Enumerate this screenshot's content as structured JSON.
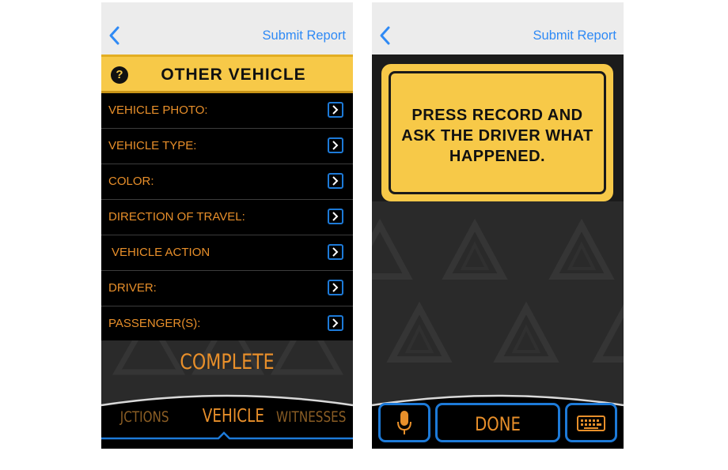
{
  "left_screen": {
    "nav": {
      "submit_label": "Submit Report"
    },
    "header": {
      "title": "OTHER VEHICLE"
    },
    "rows": [
      {
        "label": "VEHICLE PHOTO:"
      },
      {
        "label": "VEHICLE TYPE:"
      },
      {
        "label": "COLOR:"
      },
      {
        "label": "DIRECTION OF TRAVEL:"
      },
      {
        "label": "VEHICLE ACTION"
      },
      {
        "label": "DRIVER:"
      },
      {
        "label": "PASSENGER(S):"
      }
    ],
    "complete_label": "COMPLETE",
    "tabs": {
      "left": "JCTIONS",
      "active": "VEHICLE",
      "right": "WITNESSES"
    }
  },
  "right_screen": {
    "nav": {
      "submit_label": "Submit Report"
    },
    "sign": {
      "line1": "PRESS RECORD AND",
      "line2": "ASK THE DRIVER WHAT",
      "line3": "HAPPENED."
    },
    "done_label": "DONE"
  },
  "colors": {
    "accent_orange": "#e88f2a",
    "sign_yellow": "#f7c948",
    "link_blue": "#2f8af5",
    "border_blue": "#1d7ad8"
  },
  "icons": [
    "back-chevron-icon",
    "help-icon",
    "chevron-right-icon",
    "microphone-icon",
    "keyboard-icon"
  ]
}
